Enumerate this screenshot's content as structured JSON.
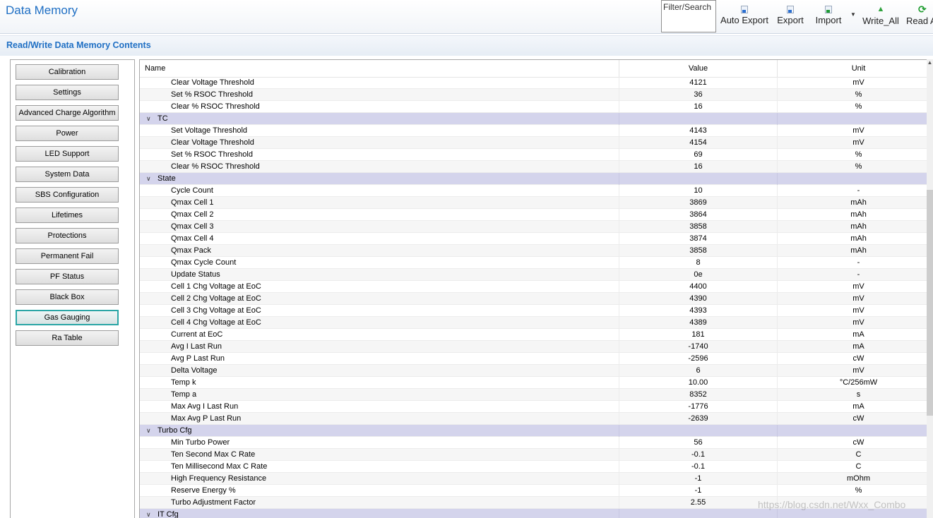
{
  "header": {
    "title": "Data Memory",
    "filter_label": "Filter/Search",
    "toolbar": [
      {
        "label": "Auto Export",
        "icon": "export-doc-icon"
      },
      {
        "label": "Export",
        "icon": "export-doc-icon"
      },
      {
        "label": "Import",
        "icon": "import-doc-icon"
      },
      {
        "label": "Write_All",
        "icon": "arrow-up-icon"
      },
      {
        "label": "Read A",
        "icon": "refresh-icon"
      }
    ],
    "import_dropdown": "▼"
  },
  "section_title": "Read/Write Data Memory Contents",
  "sidebar": {
    "items": [
      {
        "label": "Calibration"
      },
      {
        "label": "Settings"
      },
      {
        "label": "Advanced Charge Algorithm"
      },
      {
        "label": "Power"
      },
      {
        "label": "LED Support"
      },
      {
        "label": "System Data"
      },
      {
        "label": "SBS Configuration"
      },
      {
        "label": "Lifetimes"
      },
      {
        "label": "Protections"
      },
      {
        "label": "Permanent Fail"
      },
      {
        "label": "PF Status"
      },
      {
        "label": "Black Box"
      },
      {
        "label": "Gas Gauging",
        "active": true
      },
      {
        "label": "Ra Table"
      }
    ]
  },
  "table": {
    "columns": {
      "name": "Name",
      "value": "Value",
      "unit": "Unit"
    },
    "rows": [
      {
        "name": "Clear Voltage Threshold",
        "value": "4121",
        "unit": "mV"
      },
      {
        "name": "Set % RSOC Threshold",
        "value": "36",
        "unit": "%"
      },
      {
        "name": "Clear % RSOC Threshold",
        "value": "16",
        "unit": "%"
      },
      {
        "group": true,
        "name": "TC"
      },
      {
        "name": "Set Voltage Threshold",
        "value": "4143",
        "unit": "mV"
      },
      {
        "name": "Clear Voltage Threshold",
        "value": "4154",
        "unit": "mV"
      },
      {
        "name": "Set % RSOC Threshold",
        "value": "69",
        "unit": "%"
      },
      {
        "name": "Clear % RSOC Threshold",
        "value": "16",
        "unit": "%"
      },
      {
        "group": true,
        "name": "State"
      },
      {
        "name": "Cycle Count",
        "value": "10",
        "unit": "-"
      },
      {
        "name": "Qmax Cell 1",
        "value": "3869",
        "unit": "mAh"
      },
      {
        "name": "Qmax Cell 2",
        "value": "3864",
        "unit": "mAh"
      },
      {
        "name": "Qmax Cell 3",
        "value": "3858",
        "unit": "mAh"
      },
      {
        "name": "Qmax Cell 4",
        "value": "3874",
        "unit": "mAh"
      },
      {
        "name": "Qmax Pack",
        "value": "3858",
        "unit": "mAh"
      },
      {
        "name": "Qmax Cycle Count",
        "value": "8",
        "unit": "-"
      },
      {
        "name": "Update Status",
        "value": "0e",
        "unit": "-"
      },
      {
        "name": "Cell 1 Chg Voltage at EoC",
        "value": "4400",
        "unit": "mV"
      },
      {
        "name": "Cell 2 Chg Voltage at EoC",
        "value": "4390",
        "unit": "mV"
      },
      {
        "name": "Cell 3 Chg Voltage at EoC",
        "value": "4393",
        "unit": "mV"
      },
      {
        "name": "Cell 4 Chg Voltage at EoC",
        "value": "4389",
        "unit": "mV"
      },
      {
        "name": "Current at EoC",
        "value": "181",
        "unit": "mA"
      },
      {
        "name": "Avg I Last Run",
        "value": "-1740",
        "unit": "mA"
      },
      {
        "name": "Avg P Last Run",
        "value": "-2596",
        "unit": "cW"
      },
      {
        "name": "Delta Voltage",
        "value": "6",
        "unit": "mV"
      },
      {
        "name": "Temp k",
        "value": "10.00",
        "unit": "°C/256mW"
      },
      {
        "name": "Temp a",
        "value": "8352",
        "unit": "s"
      },
      {
        "name": "Max Avg I Last Run",
        "value": "-1776",
        "unit": "mA"
      },
      {
        "name": "Max Avg P Last Run",
        "value": "-2639",
        "unit": "cW"
      },
      {
        "group": true,
        "name": "Turbo Cfg"
      },
      {
        "name": "Min Turbo Power",
        "value": "56",
        "unit": "cW"
      },
      {
        "name": "Ten Second Max C Rate",
        "value": "-0.1",
        "unit": "C"
      },
      {
        "name": "Ten Millisecond Max C Rate",
        "value": "-0.1",
        "unit": "C"
      },
      {
        "name": "High Frequency Resistance",
        "value": "-1",
        "unit": "mOhm"
      },
      {
        "name": "Reserve Energy %",
        "value": "-1",
        "unit": "%"
      },
      {
        "name": "Turbo Adjustment Factor",
        "value": "2.55",
        "unit": ""
      },
      {
        "group": true,
        "name": "IT Cfg"
      }
    ]
  },
  "watermark": "https://blog.csdn.net/Wxx_Combo",
  "colors": {
    "accent": "#1f6fc4",
    "group_row": "#d4d4ec",
    "active_border": "#2aa6a6"
  }
}
